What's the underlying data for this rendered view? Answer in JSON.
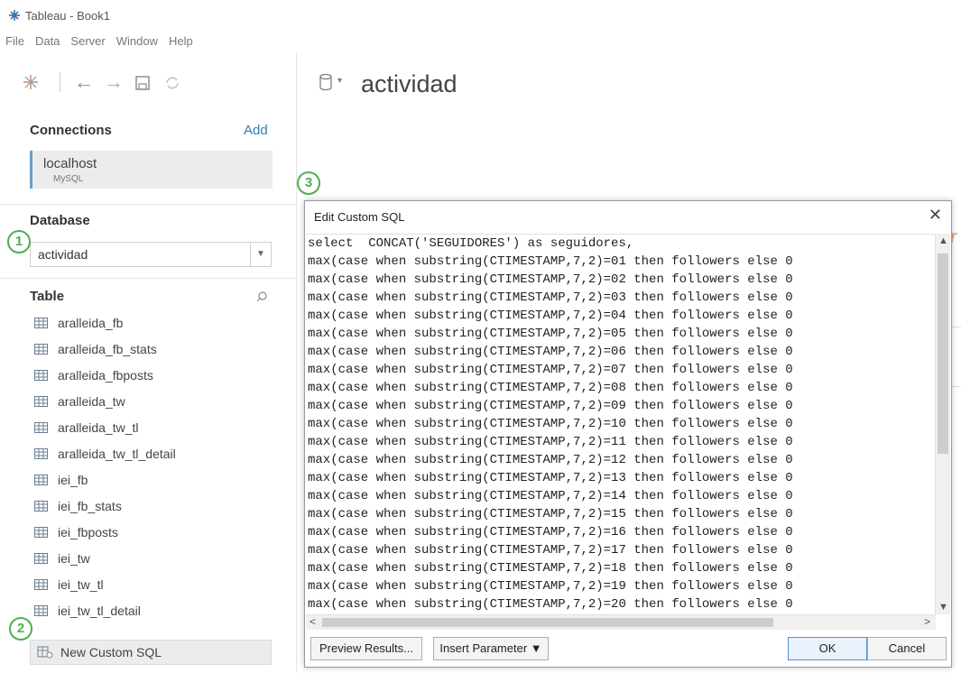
{
  "window": {
    "title": "Tableau - Book1"
  },
  "menu": [
    "File",
    "Data",
    "Server",
    "Window",
    "Help"
  ],
  "sidebar": {
    "connections_header": "Connections",
    "add_label": "Add",
    "connection": {
      "name": "localhost",
      "type": "MySQL"
    },
    "database_header": "Database",
    "database_value": "actividad",
    "table_header": "Table",
    "tables": [
      "aralleida_fb",
      "aralleida_fb_stats",
      "aralleida_fbposts",
      "aralleida_tw",
      "aralleida_tw_tl",
      "aralleida_tw_tl_detail",
      "iei_fb",
      "iei_fb_stats",
      "iei_fbposts",
      "iei_tw",
      "iei_tw_tl",
      "iei_tw_tl_detail"
    ],
    "new_custom_sql": "New Custom SQL"
  },
  "markers": {
    "m1": "1",
    "m2": "2",
    "m3": "3"
  },
  "datasource": {
    "name": "actividad"
  },
  "background_letter": "r",
  "dialog": {
    "title": "Edit Custom SQL",
    "close": "✕",
    "lines": [
      "select  CONCAT('SEGUIDORES') as seguidores,",
      "max(case when substring(CTIMESTAMP,7,2)=01 then followers else 0",
      "max(case when substring(CTIMESTAMP,7,2)=02 then followers else 0",
      "max(case when substring(CTIMESTAMP,7,2)=03 then followers else 0",
      "max(case when substring(CTIMESTAMP,7,2)=04 then followers else 0",
      "max(case when substring(CTIMESTAMP,7,2)=05 then followers else 0",
      "max(case when substring(CTIMESTAMP,7,2)=06 then followers else 0",
      "max(case when substring(CTIMESTAMP,7,2)=07 then followers else 0",
      "max(case when substring(CTIMESTAMP,7,2)=08 then followers else 0",
      "max(case when substring(CTIMESTAMP,7,2)=09 then followers else 0",
      "max(case when substring(CTIMESTAMP,7,2)=10 then followers else 0",
      "max(case when substring(CTIMESTAMP,7,2)=11 then followers else 0",
      "max(case when substring(CTIMESTAMP,7,2)=12 then followers else 0",
      "max(case when substring(CTIMESTAMP,7,2)=13 then followers else 0",
      "max(case when substring(CTIMESTAMP,7,2)=14 then followers else 0",
      "max(case when substring(CTIMESTAMP,7,2)=15 then followers else 0",
      "max(case when substring(CTIMESTAMP,7,2)=16 then followers else 0",
      "max(case when substring(CTIMESTAMP,7,2)=17 then followers else 0",
      "max(case when substring(CTIMESTAMP,7,2)=18 then followers else 0",
      "max(case when substring(CTIMESTAMP,7,2)=19 then followers else 0",
      "max(case when substring(CTIMESTAMP,7,2)=20 then followers else 0"
    ],
    "preview_button": "Preview Results...",
    "insert_button": "Insert Parameter ▼",
    "ok_button": "OK",
    "cancel_button": "Cancel"
  },
  "colors": {
    "marker": "#4caf50",
    "accent": "#2e7ea6",
    "selection": "#6a9dc2"
  }
}
